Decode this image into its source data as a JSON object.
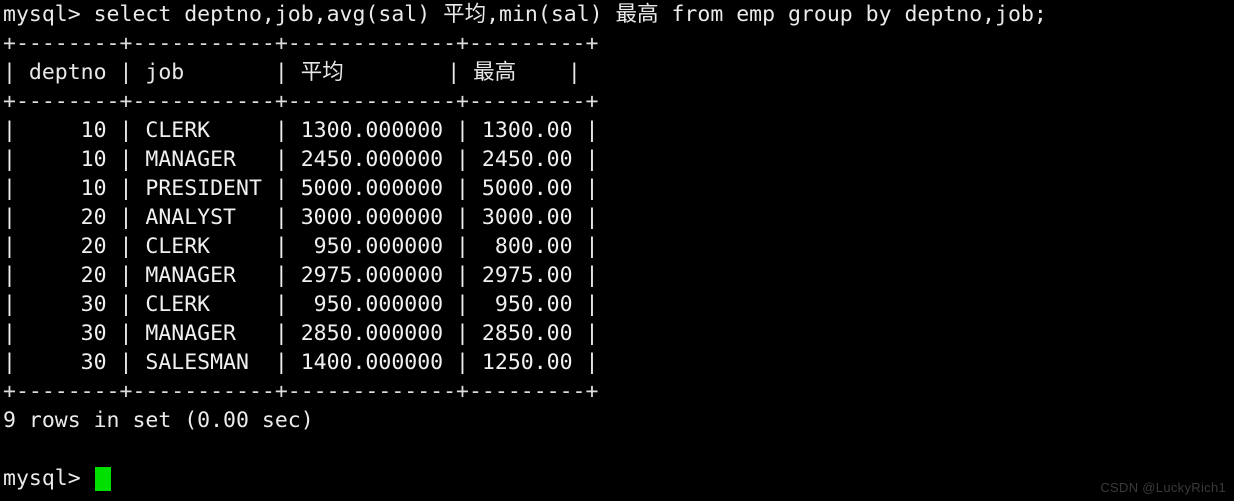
{
  "terminal": {
    "background_color": "#000000",
    "foreground_color": "#e8e8e8",
    "cursor_color": "#00e000",
    "prompt": "mysql> ",
    "command": "mysql> select deptno,job,avg(sal) 平均,min(sal) 最高 from emp group by deptno,job;",
    "separator": "+--------+-----------+-------------+---------+",
    "header_row": "| deptno | job       | 平均        | 最高    |",
    "rows": [
      "|     10 | CLERK     | 1300.000000 | 1300.00 |",
      "|     10 | MANAGER   | 2450.000000 | 2450.00 |",
      "|     10 | PRESIDENT | 5000.000000 | 5000.00 |",
      "|     20 | ANALYST   | 3000.000000 | 3000.00 |",
      "|     20 | CLERK     |  950.000000 |  800.00 |",
      "|     20 | MANAGER   | 2975.000000 | 2975.00 |",
      "|     30 | CLERK     |  950.000000 |  950.00 |",
      "|     30 | MANAGER   | 2850.000000 | 2850.00 |",
      "|     30 | SALESMAN  | 1400.000000 | 1250.00 |"
    ],
    "status": "9 rows in set (0.00 sec)",
    "final_prompt": "mysql> ",
    "watermark": "CSDN @LuckyRich1"
  },
  "table": {
    "columns": [
      "deptno",
      "job",
      "平均",
      "最高"
    ],
    "data": [
      {
        "deptno": "10",
        "job": "CLERK",
        "avg": "1300.000000",
        "min": "1300.00"
      },
      {
        "deptno": "10",
        "job": "MANAGER",
        "avg": "2450.000000",
        "min": "2450.00"
      },
      {
        "deptno": "10",
        "job": "PRESIDENT",
        "avg": "5000.000000",
        "min": "5000.00"
      },
      {
        "deptno": "20",
        "job": "ANALYST",
        "avg": "3000.000000",
        "min": "3000.00"
      },
      {
        "deptno": "20",
        "job": "CLERK",
        "avg": "950.000000",
        "min": "800.00"
      },
      {
        "deptno": "20",
        "job": "MANAGER",
        "avg": "2975.000000",
        "min": "2975.00"
      },
      {
        "deptno": "30",
        "job": "CLERK",
        "avg": "950.000000",
        "min": "950.00"
      },
      {
        "deptno": "30",
        "job": "MANAGER",
        "avg": "2850.000000",
        "min": "2850.00"
      },
      {
        "deptno": "30",
        "job": "SALESMAN",
        "avg": "1400.000000",
        "min": "1250.00"
      }
    ],
    "row_count": 9,
    "elapsed": "0.00 sec"
  }
}
